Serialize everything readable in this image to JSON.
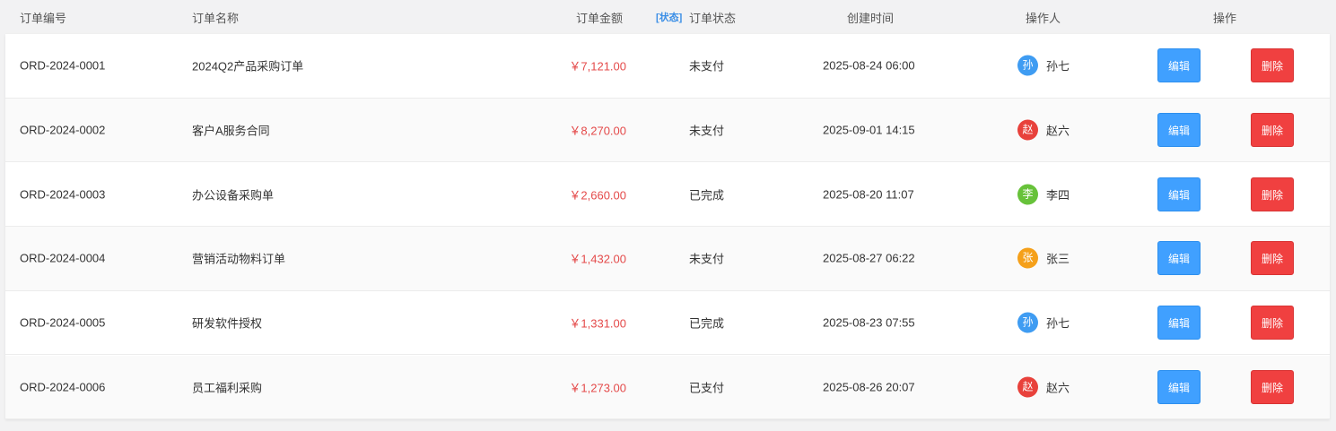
{
  "columns": {
    "order_no": "订单编号",
    "order_name": "订单名称",
    "amount": "订单金额",
    "status_tag": "[状态]",
    "status": "订单状态",
    "created": "创建时间",
    "operator": "操作人",
    "actions": "操作"
  },
  "colors": {
    "amount": "#e44a4a",
    "edit_button": "#40a0ff",
    "delete_button": "#f04040",
    "avatar_blue": "#3f9cf2",
    "avatar_red": "#e8413b",
    "avatar_green": "#67c23a",
    "avatar_orange": "#f5a01a"
  },
  "rows": [
    {
      "order_no": "ORD-2024-0001",
      "order_name": "2024Q2产品采购订单",
      "amount": "￥7,121.00",
      "status": "未支付",
      "created": "2025-08-24 06:00",
      "operator_initial": "孙",
      "operator": "孙七",
      "avatar_color": "#3f9cf2",
      "edit": "编辑",
      "delete": "删除"
    },
    {
      "order_no": "ORD-2024-0002",
      "order_name": "客户A服务合同",
      "amount": "￥8,270.00",
      "status": "未支付",
      "created": "2025-09-01 14:15",
      "operator_initial": "赵",
      "operator": "赵六",
      "avatar_color": "#e8413b",
      "edit": "编辑",
      "delete": "删除"
    },
    {
      "order_no": "ORD-2024-0003",
      "order_name": "办公设备采购单",
      "amount": "￥2,660.00",
      "status": "已完成",
      "created": "2025-08-20 11:07",
      "operator_initial": "李",
      "operator": "李四",
      "avatar_color": "#67c23a",
      "edit": "编辑",
      "delete": "删除"
    },
    {
      "order_no": "ORD-2024-0004",
      "order_name": "营销活动物料订单",
      "amount": "￥1,432.00",
      "status": "未支付",
      "created": "2025-08-27 06:22",
      "operator_initial": "张",
      "operator": "张三",
      "avatar_color": "#f5a01a",
      "edit": "编辑",
      "delete": "删除"
    },
    {
      "order_no": "ORD-2024-0005",
      "order_name": "研发软件授权",
      "amount": "￥1,331.00",
      "status": "已完成",
      "created": "2025-08-23 07:55",
      "operator_initial": "孙",
      "operator": "孙七",
      "avatar_color": "#3f9cf2",
      "edit": "编辑",
      "delete": "删除"
    },
    {
      "order_no": "ORD-2024-0006",
      "order_name": "员工福利采购",
      "amount": "￥1,273.00",
      "status": "已支付",
      "created": "2025-08-26 20:07",
      "operator_initial": "赵",
      "operator": "赵六",
      "avatar_color": "#e8413b",
      "edit": "编辑",
      "delete": "删除"
    }
  ]
}
